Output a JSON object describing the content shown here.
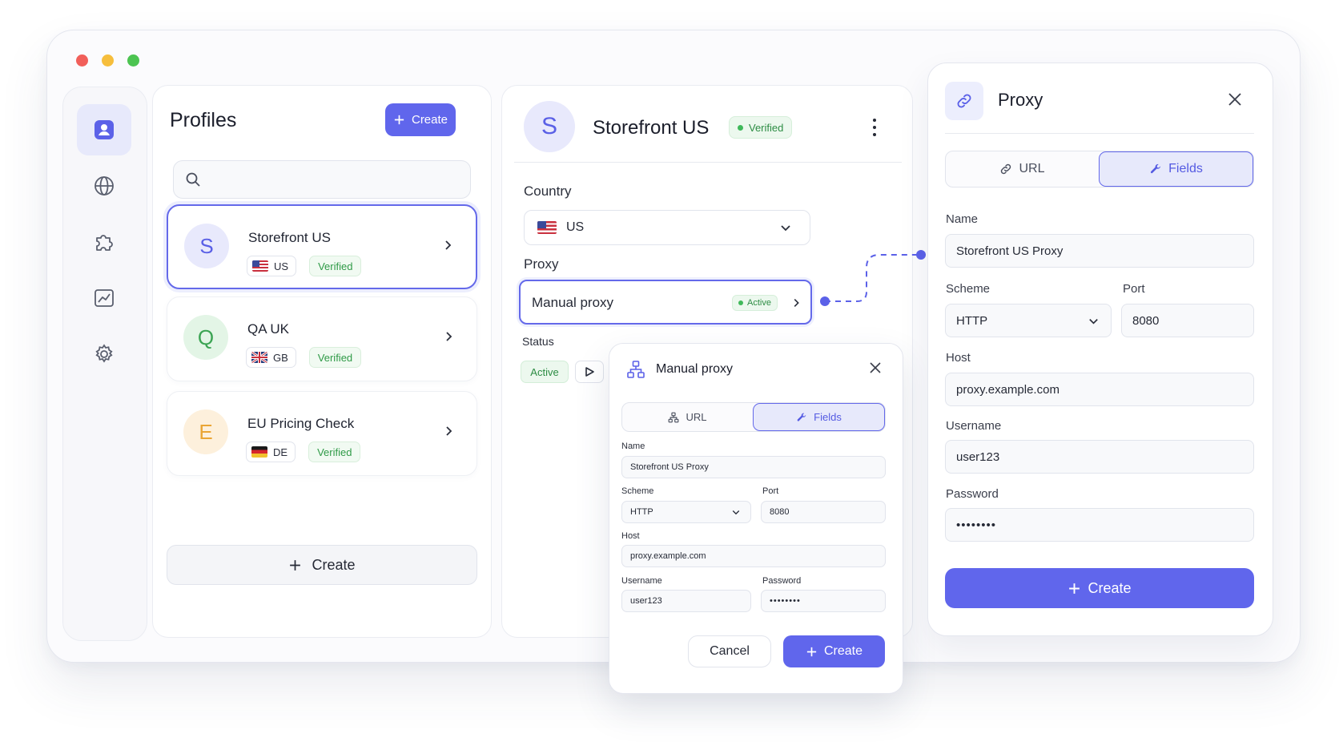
{
  "window": {
    "dots": [
      "close",
      "minimize",
      "maximize"
    ]
  },
  "rail": {
    "items": [
      {
        "icon": "user-icon",
        "active": true
      },
      {
        "icon": "globe-icon",
        "active": false
      },
      {
        "icon": "puzzle-icon",
        "active": false
      },
      {
        "icon": "chart-icon",
        "active": false
      },
      {
        "icon": "gear-icon",
        "active": false
      }
    ]
  },
  "profiles": {
    "title": "Profiles",
    "create_label": "Create",
    "search": {
      "placeholder": "",
      "value": ""
    },
    "items": [
      {
        "initial": "S",
        "name": "Storefront US",
        "country": "US",
        "status": "Verified",
        "selected": true
      },
      {
        "initial": "Q",
        "name": "QA UK",
        "country": "GB",
        "status": "Verified",
        "selected": false
      },
      {
        "initial": "E",
        "name": "EU Pricing Check",
        "country": "DE",
        "status": "Verified",
        "selected": false
      }
    ],
    "bottom_create_label": "Create"
  },
  "detail": {
    "initial": "S",
    "name": "Storefront US",
    "status": "Verified",
    "country_label": "Country",
    "country_value": "US",
    "proxy_label": "Proxy",
    "proxy_value": "Manual proxy",
    "proxy_status": "Active",
    "status_label": "Status",
    "status_value": "Active"
  },
  "popup": {
    "title": "Manual proxy",
    "tabs": [
      "URL",
      "Fields"
    ],
    "active_tab": "Fields",
    "name_label": "Name",
    "name_value": "Storefront US Proxy",
    "scheme_label": "Scheme",
    "scheme_value": "HTTP",
    "port_label": "Port",
    "port_value": "8080",
    "host_label": "Host",
    "host_value": "proxy.example.com",
    "username_label": "Username",
    "username_value": "user123",
    "password_label": "Password",
    "password_value": "••••••••",
    "cancel_label": "Cancel",
    "create_label": "Create"
  },
  "proxy_panel": {
    "title": "Proxy",
    "tabs": [
      "URL",
      "Fields"
    ],
    "active_tab": "Fields",
    "name_label": "Name",
    "name_value": "Storefront US Proxy",
    "scheme_label": "Scheme",
    "scheme_value": "HTTP",
    "port_label": "Port",
    "port_value": "8080",
    "host_label": "Host",
    "host_value": "proxy.example.com",
    "username_label": "Username",
    "username_value": "user123",
    "password_label": "Password",
    "password_value": "••••••••",
    "create_label": "Create"
  },
  "colors": {
    "accent": "#6066ec",
    "accent_soft": "#e7e9fb",
    "success": "#2f9a47",
    "success_soft": "#ecf8ee"
  }
}
